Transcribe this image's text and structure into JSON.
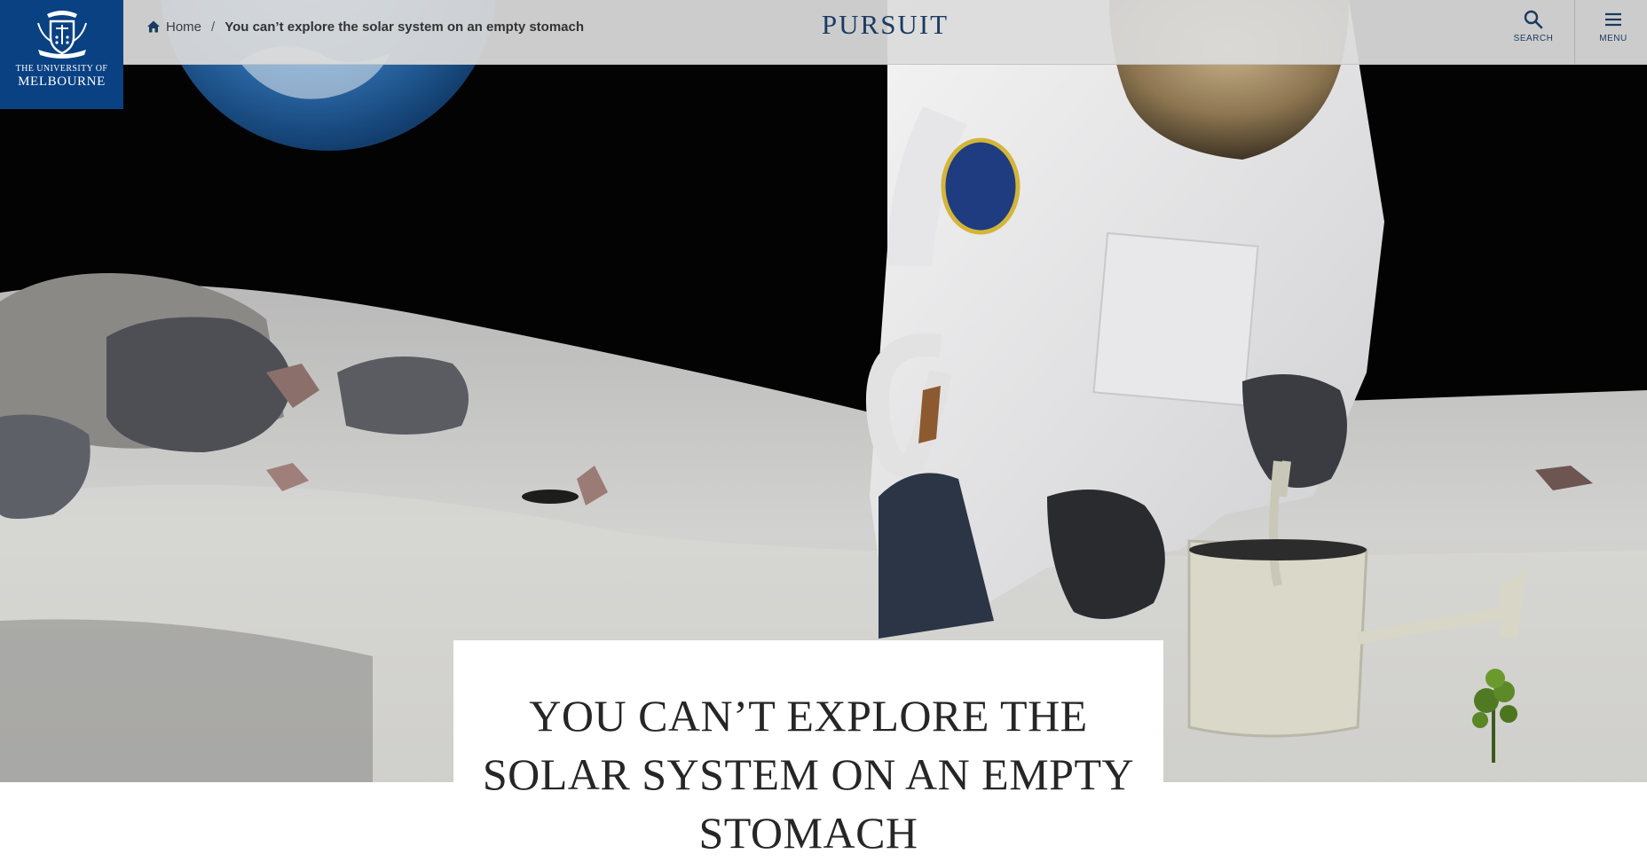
{
  "logo": {
    "line1": "THE UNIVERSITY OF",
    "line2": "MELBOURNE"
  },
  "breadcrumb": {
    "home": "Home",
    "separator": "/",
    "current": "You can’t explore the solar system on an empty stomach"
  },
  "brand": "PURSUIT",
  "tools": {
    "search": "SEARCH",
    "menu": "MENU"
  },
  "hero": {
    "alt": "Astronaut kneeling on a lunar surface watering a small plant with a watering can, Earth visible in the black sky"
  },
  "article": {
    "title_lines": [
      "YOU CAN’T EXPLORE THE",
      "SOLAR SYSTEM ON AN EMPTY",
      "STOMACH"
    ]
  },
  "colors": {
    "logo_bg": "#094183",
    "brand_text": "#1c3c60",
    "topbar_bg": "#dcdcdc"
  }
}
